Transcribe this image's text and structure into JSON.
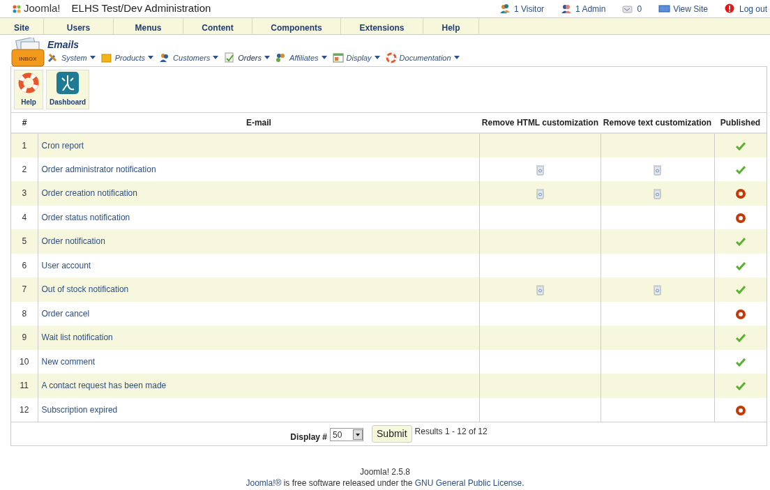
{
  "header": {
    "logo": "Joomla!",
    "site_title": "ELHS Test/Dev Administration",
    "status": [
      {
        "kind": "visitors",
        "text": "1 Visitor"
      },
      {
        "kind": "admins",
        "text": "1 Admin"
      },
      {
        "kind": "messages",
        "text": "0"
      },
      {
        "kind": "view",
        "text": "View Site"
      },
      {
        "kind": "logout",
        "text": "Log out"
      }
    ]
  },
  "main_menu": [
    "Site",
    "Users",
    "Menus",
    "Content",
    "Components",
    "Extensions",
    "Help"
  ],
  "component": {
    "title": "Emails",
    "inbox_label": "INBOX",
    "submenu": [
      {
        "kind": "system",
        "label": "System",
        "selected": false
      },
      {
        "kind": "products",
        "label": "Products",
        "selected": false
      },
      {
        "kind": "customers",
        "label": "Customers",
        "selected": false
      },
      {
        "kind": "orders",
        "label": "Orders",
        "selected": true
      },
      {
        "kind": "affiliates",
        "label": "Affiliates",
        "selected": false
      },
      {
        "kind": "display",
        "label": "Display",
        "selected": false
      },
      {
        "kind": "documentation",
        "label": "Documentation",
        "selected": false
      }
    ]
  },
  "toolbar": [
    {
      "kind": "help",
      "label": "Help"
    },
    {
      "kind": "dashboard",
      "label": "Dashboard"
    }
  ],
  "table": {
    "columns": [
      "#",
      "E-mail",
      "Remove HTML customization",
      "Remove text customization",
      "Published"
    ],
    "rows": [
      {
        "num": "1",
        "name": "Cron report",
        "remove_html": false,
        "remove_text": false,
        "published": true
      },
      {
        "num": "2",
        "name": "Order administrator notification",
        "remove_html": true,
        "remove_text": true,
        "published": true
      },
      {
        "num": "3",
        "name": "Order creation notification",
        "remove_html": true,
        "remove_text": true,
        "published": false
      },
      {
        "num": "4",
        "name": "Order status notification",
        "remove_html": false,
        "remove_text": false,
        "published": false
      },
      {
        "num": "5",
        "name": "Order notification",
        "remove_html": false,
        "remove_text": false,
        "published": true
      },
      {
        "num": "6",
        "name": "User account",
        "remove_html": false,
        "remove_text": false,
        "published": true
      },
      {
        "num": "7",
        "name": "Out of stock notification",
        "remove_html": true,
        "remove_text": true,
        "published": true
      },
      {
        "num": "8",
        "name": "Order cancel",
        "remove_html": false,
        "remove_text": false,
        "published": false
      },
      {
        "num": "9",
        "name": "Wait list notification",
        "remove_html": false,
        "remove_text": false,
        "published": true
      },
      {
        "num": "10",
        "name": "New comment",
        "remove_html": false,
        "remove_text": false,
        "published": true
      },
      {
        "num": "11",
        "name": "A contact request has been made",
        "remove_html": false,
        "remove_text": false,
        "published": true
      },
      {
        "num": "12",
        "name": "Subscription expired",
        "remove_html": false,
        "remove_text": false,
        "published": false
      }
    ]
  },
  "pagination": {
    "label": "Display #",
    "value": "50",
    "button": "Submit",
    "results": "Results 1 - 12 of 12"
  },
  "footer": {
    "version": "Joomla! 2.5.8",
    "license_link": "Joomla!®",
    "license_middle": " is free software released under the ",
    "license_name_link": "GNU General Public License",
    "license_end": "."
  }
}
